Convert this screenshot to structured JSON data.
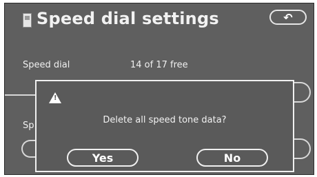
{
  "header": {
    "title": "Speed dial settings",
    "back_icon": "return-arrow-icon",
    "back_symbol": "↶"
  },
  "speed_dial_row": {
    "label": "Speed dial",
    "value": "14 of 17 free"
  },
  "background_partial_label": "Sp",
  "dialog": {
    "warning_icon": "warning-triangle-icon",
    "message": "Delete all speed tone data?",
    "yes_label": "Yes",
    "no_label": "No"
  },
  "colors": {
    "screen_background": "#5f5f5f",
    "text": "#f2f2f2",
    "outline": "#f0f0f0"
  }
}
